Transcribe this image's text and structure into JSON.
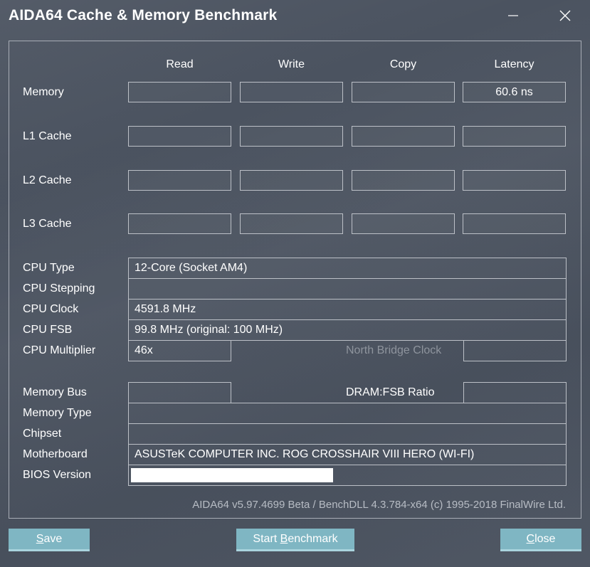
{
  "window": {
    "title": "AIDA64 Cache & Memory Benchmark"
  },
  "columns": [
    "Read",
    "Write",
    "Copy",
    "Latency"
  ],
  "rows": [
    {
      "label": "Memory",
      "values": [
        "",
        "",
        "",
        "60.6 ns"
      ]
    },
    {
      "label": "L1 Cache",
      "values": [
        "",
        "",
        "",
        ""
      ]
    },
    {
      "label": "L2 Cache",
      "values": [
        "",
        "",
        "",
        ""
      ]
    },
    {
      "label": "L3 Cache",
      "values": [
        "",
        "",
        "",
        ""
      ]
    }
  ],
  "cpu": {
    "type_label": "CPU Type",
    "type_value": "12-Core   (Socket AM4)",
    "stepping_label": "CPU Stepping",
    "stepping_value": "",
    "clock_label": "CPU Clock",
    "clock_value": "4591.8 MHz",
    "fsb_label": "CPU FSB",
    "fsb_value": "99.8 MHz  (original: 100 MHz)",
    "multiplier_label": "CPU Multiplier",
    "multiplier_value": "46x",
    "nb_clock_label": "North Bridge Clock",
    "nb_clock_value": ""
  },
  "memory": {
    "bus_label": "Memory Bus",
    "bus_value": "",
    "dram_ratio_label": "DRAM:FSB Ratio",
    "dram_ratio_value": "",
    "type_label": "Memory Type",
    "type_value": "",
    "chipset_label": "Chipset",
    "chipset_value": "",
    "motherboard_label": "Motherboard",
    "motherboard_value": "ASUSTeK COMPUTER INC. ROG CROSSHAIR VIII HERO (WI-FI)",
    "bios_label": "BIOS Version",
    "bios_value": ""
  },
  "footer": {
    "version": "AIDA64 v5.97.4699 Beta / BenchDLL 4.3.784-x64  (c) 1995-2018 FinalWire Ltd."
  },
  "buttons": {
    "save_first": "S",
    "save_rest": "ave",
    "start_prefix": "Start ",
    "start_first": "B",
    "start_rest": "enchmark",
    "close_first": "C",
    "close_rest": "lose"
  },
  "icons": {
    "minimize": "minimize-icon",
    "close": "close-icon"
  }
}
